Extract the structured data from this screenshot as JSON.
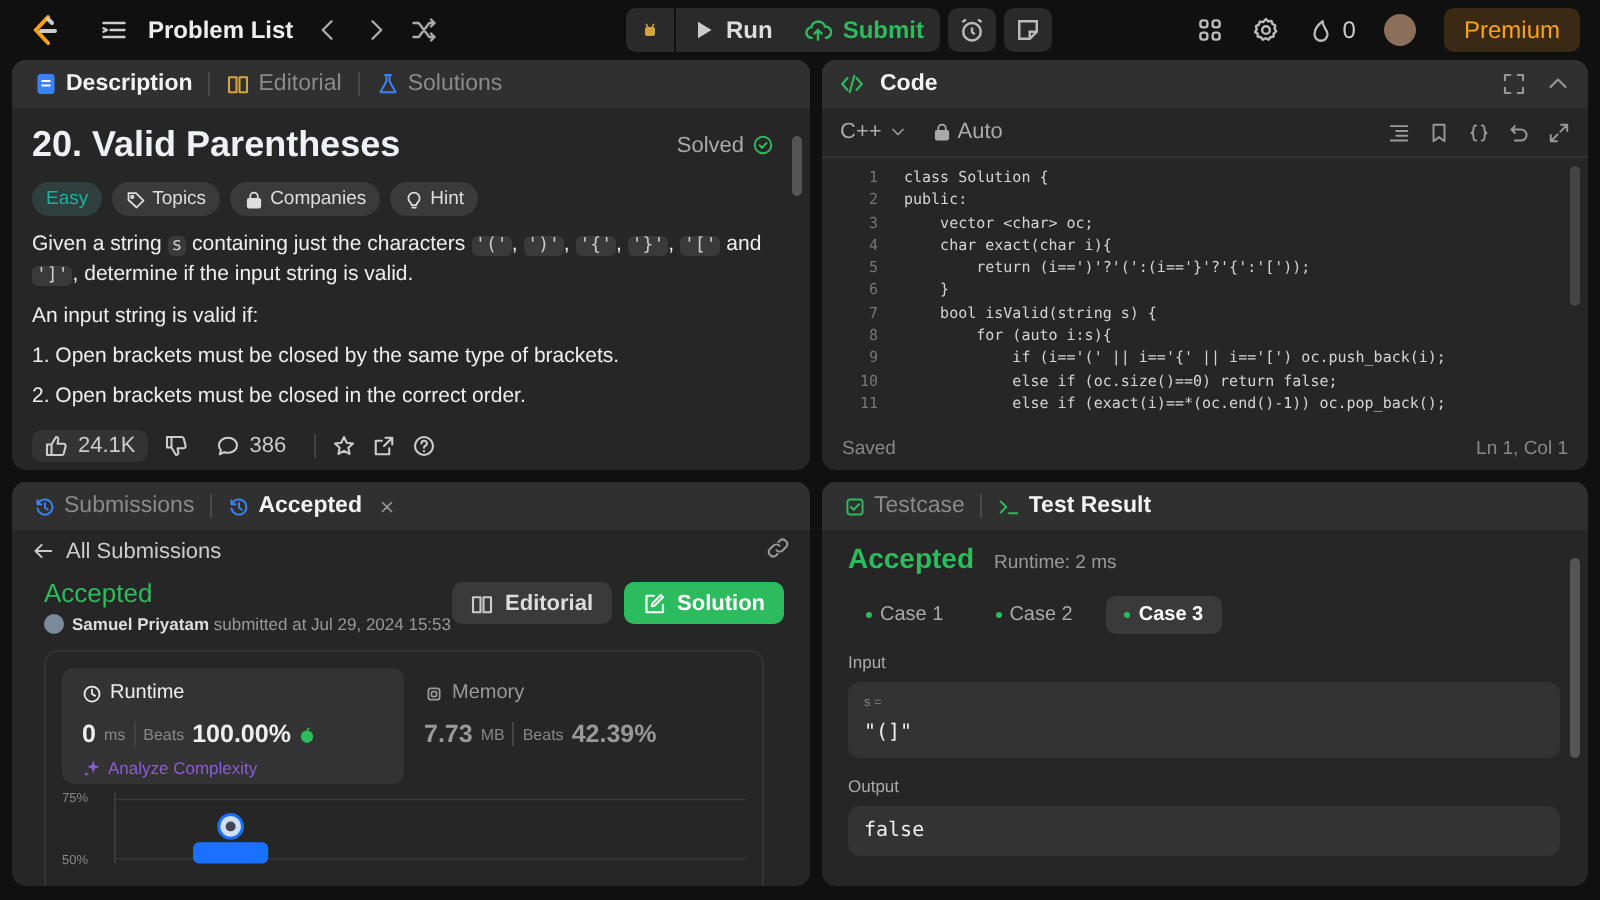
{
  "top_bar": {
    "nav_label": "Problem List",
    "run": "Run",
    "submit": "Submit",
    "streak": "0",
    "premium": "Premium"
  },
  "description_panel": {
    "tabs": [
      {
        "label": "Description",
        "selected": true
      },
      {
        "label": "Editorial",
        "selected": false
      },
      {
        "label": "Solutions",
        "selected": false
      }
    ],
    "title": "20. Valid Parentheses",
    "status": "Solved",
    "tags": [
      {
        "label": "Easy",
        "kind": "difficulty"
      },
      {
        "label": "Topics",
        "kind": "topics"
      },
      {
        "label": "Companies",
        "kind": "companies"
      },
      {
        "label": "Hint",
        "kind": "hint"
      }
    ],
    "paragraphs": [
      {
        "parts": [
          {
            "text": "Given a string ",
            "kind": "text"
          },
          {
            "text": "s",
            "kind": "code"
          },
          {
            "text": " containing just the characters ",
            "kind": "text"
          },
          {
            "text": "'('",
            "kind": "code"
          },
          {
            "text": ", ",
            "kind": "text"
          },
          {
            "text": "')'",
            "kind": "code"
          },
          {
            "text": ", ",
            "kind": "text"
          },
          {
            "text": "'{'",
            "kind": "code"
          },
          {
            "text": ", ",
            "kind": "text"
          },
          {
            "text": "'}'",
            "kind": "code"
          },
          {
            "text": ", ",
            "kind": "text"
          },
          {
            "text": "'['",
            "kind": "code"
          },
          {
            "text": " and ",
            "kind": "text"
          },
          {
            "text": "']'",
            "kind": "code"
          },
          {
            "text": ", determine if the input string is valid.",
            "kind": "text"
          }
        ]
      },
      {
        "parts": [
          {
            "text": "An input string is valid if:",
            "kind": "text"
          }
        ]
      },
      {
        "parts": [
          {
            "text": "1. Open brackets must be closed by the same type of brackets.",
            "kind": "text"
          }
        ]
      },
      {
        "parts": [
          {
            "text": "2. Open brackets must be closed in the correct order.",
            "kind": "text"
          }
        ]
      }
    ],
    "likes": "24.1K",
    "comments": "386"
  },
  "code_panel": {
    "title": "Code",
    "language": "C++",
    "mode": "Auto",
    "lines": [
      {
        "number": "1",
        "text": "class Solution {"
      },
      {
        "number": "2",
        "text": "public:"
      },
      {
        "number": "3",
        "text": "    vector <char> oc;"
      },
      {
        "number": "4",
        "text": "    char exact(char i){"
      },
      {
        "number": "5",
        "text": "        return (i==')'?'(':(i=='}'?'{':'['));"
      },
      {
        "number": "6",
        "text": "    }"
      },
      {
        "number": "7",
        "text": "    bool isValid(string s) {"
      },
      {
        "number": "8",
        "text": "        for (auto i:s){"
      },
      {
        "number": "9",
        "text": "            if (i=='(' || i=='{' || i=='[') oc.push_back(i);"
      },
      {
        "number": "10",
        "text": "            else if (oc.size()==0) return false;"
      },
      {
        "number": "11",
        "text": "            else if (exact(i)==*(oc.end()-1)) oc.pop_back();"
      }
    ],
    "status": "Saved",
    "cursor": "Ln 1, Col 1"
  },
  "submission_panel": {
    "tabs": [
      {
        "label": "Submissions",
        "selected": false
      },
      {
        "label": "Accepted",
        "selected": true
      }
    ],
    "back": "All Submissions",
    "result": "Accepted",
    "user": "Samuel Priyatam",
    "submitted": "submitted at Jul 29, 2024 15:53",
    "buttons": [
      {
        "label": "Editorial",
        "kind": "secondary"
      },
      {
        "label": "Solution",
        "kind": "primary"
      }
    ],
    "metrics": [
      {
        "kind": "runtime",
        "label": "Runtime",
        "value": "0",
        "unit": "ms",
        "beats_label": "Beats",
        "beats": "100.00%",
        "selected": true
      },
      {
        "kind": "memory",
        "label": "Memory",
        "value": "7.73",
        "unit": "MB",
        "beats_label": "Beats",
        "beats": "42.39%",
        "selected": false
      }
    ],
    "analyze": "Analyze Complexity",
    "chart_data": {
      "type": "bar",
      "values": [
        57
      ],
      "ylim": [
        48,
        78
      ],
      "yticks": [
        {
          "value": 75,
          "label": "75%"
        },
        {
          "value": 50,
          "label": "50%"
        }
      ]
    }
  },
  "result_panel": {
    "tabs": [
      {
        "label": "Testcase",
        "selected": false
      },
      {
        "label": "Test Result",
        "selected": true
      }
    ],
    "verdict": "Accepted",
    "runtime": "Runtime: 2 ms",
    "cases": [
      {
        "label": "Case 1",
        "selected": false,
        "passed": true
      },
      {
        "label": "Case 2",
        "selected": false,
        "passed": true
      },
      {
        "label": "Case 3",
        "selected": true,
        "passed": true
      }
    ],
    "input_label": "Input",
    "input_name": "s =",
    "input_value": "\"(]\"",
    "output_label": "Output",
    "output_value": "false"
  }
}
